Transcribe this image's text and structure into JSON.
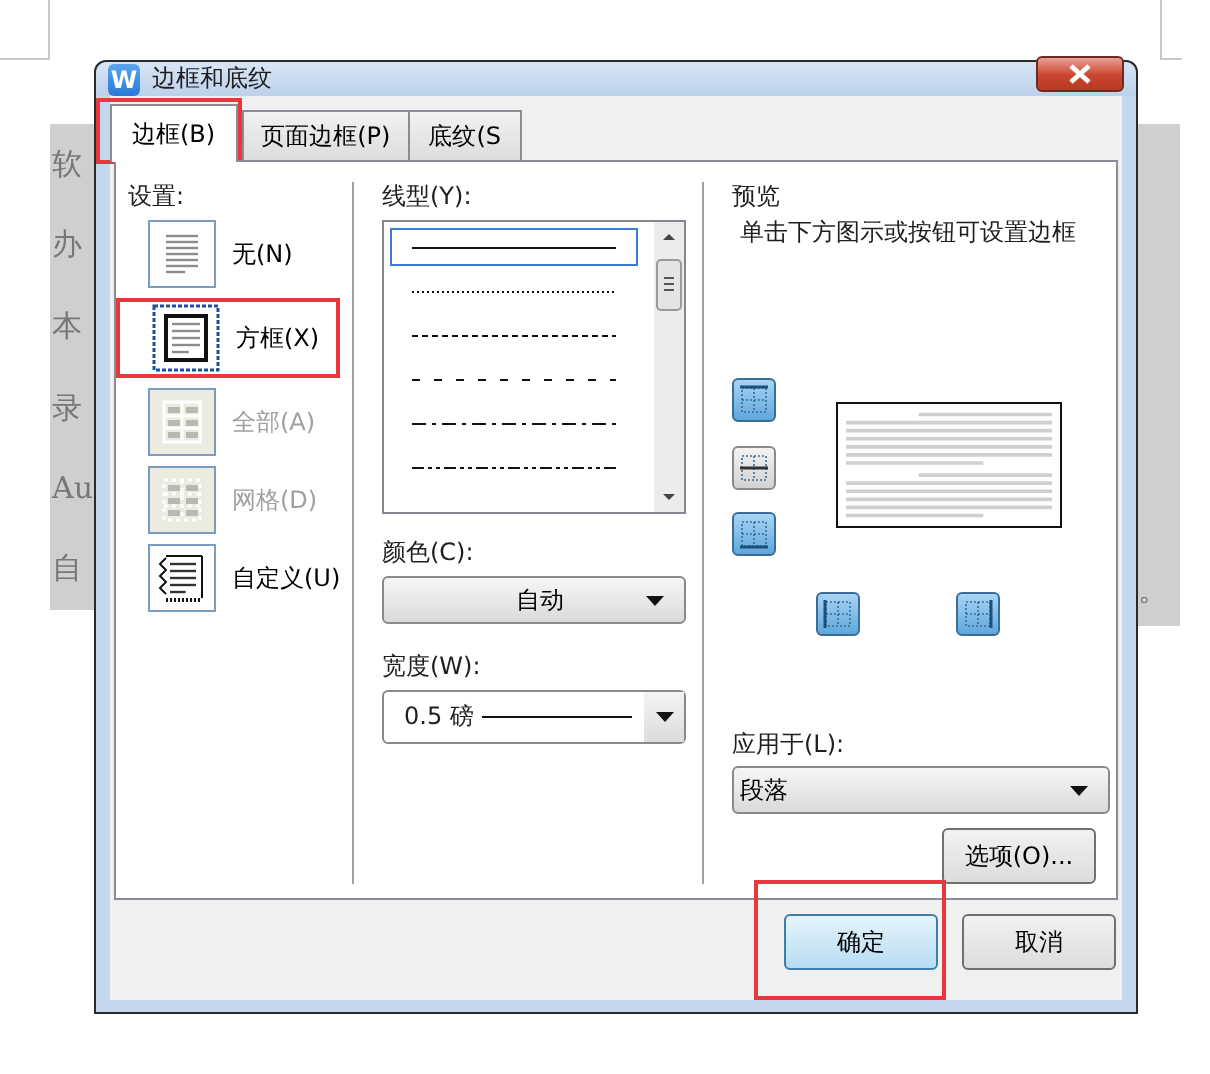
{
  "document": {
    "left_text": [
      "软",
      "办",
      "本",
      "录",
      "Au",
      "自"
    ],
    "right_text": [
      "。"
    ]
  },
  "dialog": {
    "icon_text": "W",
    "title": "边框和底纹",
    "tabs": [
      {
        "label": "边框(B)",
        "selected": true,
        "highlighted": true
      },
      {
        "label": "页面边框(P)",
        "selected": false,
        "highlighted": false
      },
      {
        "label": "底纹(S",
        "selected": false,
        "highlighted": false
      }
    ],
    "settings": {
      "label": "设置:",
      "items": [
        {
          "label": "无(N)",
          "kind": "none",
          "selected": false,
          "disabled": false,
          "highlighted": false
        },
        {
          "label": "方框(X)",
          "kind": "box",
          "selected": true,
          "disabled": false,
          "highlighted": true
        },
        {
          "label": "全部(A)",
          "kind": "all",
          "selected": false,
          "disabled": true,
          "highlighted": false
        },
        {
          "label": "网格(D)",
          "kind": "grid",
          "selected": false,
          "disabled": true,
          "highlighted": false
        },
        {
          "label": "自定义(U)",
          "kind": "custom",
          "selected": false,
          "disabled": false,
          "highlighted": false
        }
      ]
    },
    "line_style": {
      "label": "线型(Y):",
      "options": [
        {
          "kind": "solid",
          "selected": true
        },
        {
          "kind": "dotted",
          "selected": false
        },
        {
          "kind": "dashed",
          "selected": false
        },
        {
          "kind": "sparse-dashed",
          "selected": false
        },
        {
          "kind": "dash-dot",
          "selected": false
        },
        {
          "kind": "dash-dot-dot",
          "selected": false
        }
      ]
    },
    "color": {
      "label": "颜色(C):",
      "value": "自动"
    },
    "width": {
      "label": "宽度(W):",
      "value": "0.5 磅"
    },
    "preview": {
      "label": "预览",
      "hint": "单击下方图示或按钮可设置边框",
      "buttons": [
        {
          "kind": "top",
          "on": true
        },
        {
          "kind": "inner-horizontal",
          "on": false
        },
        {
          "kind": "bottom",
          "on": true
        },
        {
          "kind": "left",
          "on": true
        },
        {
          "kind": "right",
          "on": true
        }
      ]
    },
    "apply_to": {
      "label": "应用于(L):",
      "value": "段落"
    },
    "options_button": "选项(O)...",
    "buttons": [
      {
        "label": "确定",
        "kind": "default",
        "highlighted": true
      },
      {
        "label": "取消",
        "kind": "normal",
        "highlighted": false
      }
    ]
  }
}
